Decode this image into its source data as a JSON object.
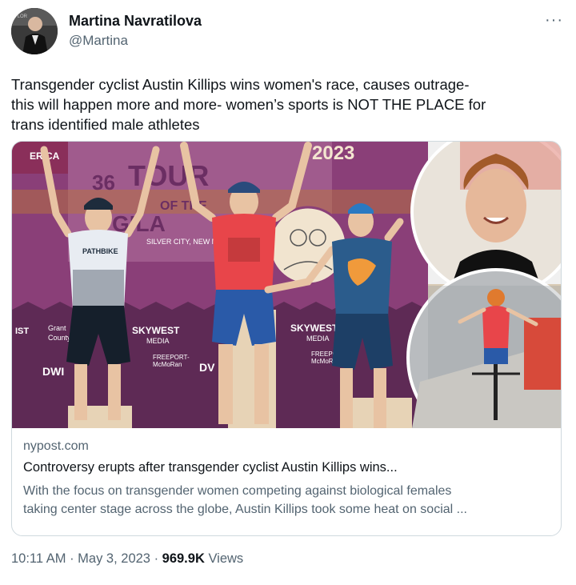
{
  "author": {
    "name": "Martina Navratilova",
    "handle": "@Martina"
  },
  "more_icon": "more-horizontal-icon",
  "tweet": {
    "line1": "Transgender cyclist Austin Killips wins women's race, causes outrage-",
    "line2": "this will happen more and more- women’s sports is NOT THE PLACE for",
    "line3": "trans identified male athletes"
  },
  "card": {
    "domain": "nypost.com",
    "headline": "Controversy erupts after transgender cyclist Austin Killips wins...",
    "desc_line1": "With the focus on transgender women competing against biological females",
    "desc_line2": "taking center stage across the globe, Austin Killips took some heat on social ...",
    "image_text": {
      "year": "2023",
      "tour_36": "36",
      "tour_word": "TOUR",
      "of_the": "OF THE",
      "gila": "GILA",
      "silver_city": "SILVER CITY, NEW ME",
      "america": "ERICA",
      "skywest1": "SKYWEST",
      "skywest1_sub": "MEDIA",
      "skywest2": "SKYWEST",
      "skywest2_sub": "MEDIA",
      "freeport1": "FREEPORT-",
      "freeport1_sub": "McMoRan",
      "freeport2": "FREEPORT-",
      "freeport2_sub": "McMoRan",
      "dw1": "DWI",
      "dw2": "DV",
      "ist": "IST",
      "grant": "Grant",
      "county": "County",
      "jersey_left": "PATHBIKE"
    }
  },
  "footer": {
    "time": "10:11 AM",
    "sep1": " · ",
    "date": "May 3, 2023",
    "sep2": " · ",
    "views_count": "969.9K",
    "views_label": " Views"
  },
  "colors": {
    "text_primary": "#0f1419",
    "text_secondary": "#536471",
    "border": "#cfd9de",
    "backdrop": "#8a3f78",
    "jersey_red": "#e8454a",
    "jersey_blue": "#2b5c8c"
  }
}
